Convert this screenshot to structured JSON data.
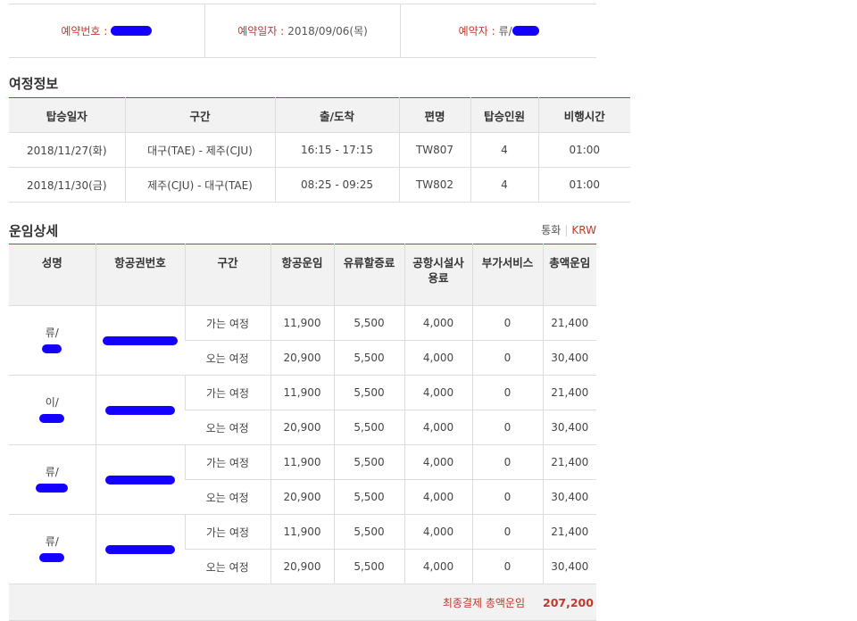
{
  "reservation": {
    "number_label": "예약번호 :",
    "date_label": "예약일자 :",
    "date_value": "2018/09/06(목)",
    "booker_label": "예약자 :",
    "booker_value": "류/"
  },
  "itinerary": {
    "title": "여정정보",
    "headers": [
      "탑승일자",
      "구간",
      "출/도착",
      "편명",
      "탑승인원",
      "비행시간"
    ],
    "rows": [
      [
        "2018/11/27(화)",
        "대구(TAE) - 제주(CJU)",
        "16:15 - 17:15",
        "TW807",
        "4",
        "01:00"
      ],
      [
        "2018/11/30(금)",
        "제주(CJU) - 대구(TAE)",
        "08:25 - 09:25",
        "TW802",
        "4",
        "01:00"
      ]
    ]
  },
  "fare": {
    "title": "운임상세",
    "currency_label": "통화",
    "currency_value": "KRW",
    "headers": [
      "성명",
      "항공권번호",
      "구간",
      "항공운임",
      "유류할증료",
      "공항시설사용료",
      "부가서비스",
      "총액운임"
    ],
    "passengers": [
      {
        "name": "류/",
        "legs": [
          {
            "segment": "가는 여정",
            "fare": "11,900",
            "fuel": "5,500",
            "airport": "4,000",
            "extra": "0",
            "total": "21,400"
          },
          {
            "segment": "오는 여정",
            "fare": "20,900",
            "fuel": "5,500",
            "airport": "4,000",
            "extra": "0",
            "total": "30,400"
          }
        ]
      },
      {
        "name": "이/",
        "legs": [
          {
            "segment": "가는 여정",
            "fare": "11,900",
            "fuel": "5,500",
            "airport": "4,000",
            "extra": "0",
            "total": "21,400"
          },
          {
            "segment": "오는 여정",
            "fare": "20,900",
            "fuel": "5,500",
            "airport": "4,000",
            "extra": "0",
            "total": "30,400"
          }
        ]
      },
      {
        "name": "류/",
        "legs": [
          {
            "segment": "가는 여정",
            "fare": "11,900",
            "fuel": "5,500",
            "airport": "4,000",
            "extra": "0",
            "total": "21,400"
          },
          {
            "segment": "오는 여정",
            "fare": "20,900",
            "fuel": "5,500",
            "airport": "4,000",
            "extra": "0",
            "total": "30,400"
          }
        ]
      },
      {
        "name": "류/",
        "legs": [
          {
            "segment": "가는 여정",
            "fare": "11,900",
            "fuel": "5,500",
            "airport": "4,000",
            "extra": "0",
            "total": "21,400"
          },
          {
            "segment": "오는 여정",
            "fare": "20,900",
            "fuel": "5,500",
            "airport": "4,000",
            "extra": "0",
            "total": "30,400"
          }
        ]
      }
    ],
    "total_label": "최종결제 총액운임",
    "total_value": "207,200"
  },
  "colors": {
    "accent": "#c0392b",
    "redaction": "#1400ff",
    "header_bg": "#f2f2f2"
  }
}
